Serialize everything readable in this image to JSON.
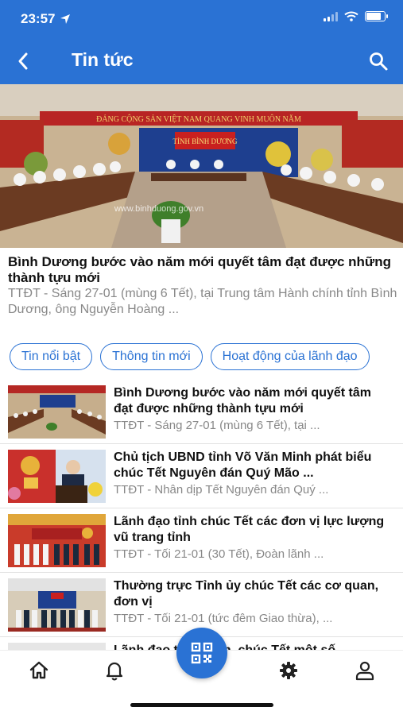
{
  "status_bar": {
    "time": "23:57",
    "battery_level": 0.8
  },
  "nav": {
    "title": "Tin tức",
    "back_icon": "chevron-left-icon",
    "search_icon": "search-icon"
  },
  "hero": {
    "banner_text": "ĐẢNG CỘNG SẢN VIỆT NAM QUANG VINH MUÔN NĂM",
    "sign_text": "TỈNH BÌNH DƯƠNG",
    "watermark": "www.binhduong.gov.vn"
  },
  "featured": {
    "title": "Bình Dương bước vào năm mới quyết tâm đạt được những thành tựu mới",
    "summary": "TTĐT - Sáng 27-01 (mùng 6 Tết), tại Trung tâm Hành chính tỉnh Bình Dương, ông Nguyễn Hoàng ..."
  },
  "categories": [
    "Tin nổi bật",
    "Thông tin mới",
    "Hoạt động của lãnh đạo"
  ],
  "articles": [
    {
      "title": "Bình Dương bước vào năm mới quyết tâm đạt được những thành tựu mới",
      "summary": "TTĐT - Sáng 27-01 (mùng 6 Tết), tại ..."
    },
    {
      "title": "Chủ tịch UBND tỉnh Võ Văn Minh phát biểu chúc Tết Nguyên đán Quý Mão ...",
      "summary": "TTĐT - Nhân dịp Tết Nguyên đán Quý ..."
    },
    {
      "title": "Lãnh đạo tỉnh chúc Tết các đơn vị lực lượng vũ trang tỉnh",
      "summary": "TTĐT - Tối 21-01 (30 Tết), Đoàn lãnh ..."
    },
    {
      "title": "Thường trực Tỉnh ủy chúc Tết các cơ quan, đơn vị",
      "summary": "TTĐT - Tối 21-01 (tức đêm Giao thừa), ..."
    },
    {
      "title": "Lãnh đạo tỉnh thăm, chúc Tết một số ...",
      "summary": ""
    }
  ],
  "tabbar": {
    "items": [
      "home-icon",
      "bell-icon",
      "qr-code-icon",
      "gear-icon",
      "user-icon"
    ],
    "accent": "#2a72d4"
  },
  "colors": {
    "primary": "#2a72d4",
    "muted_text": "#888888"
  }
}
